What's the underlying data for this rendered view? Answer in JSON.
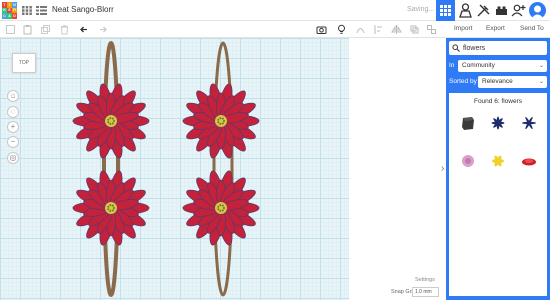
{
  "app": {
    "logo_letters": [
      "T",
      "I",
      "N",
      "K",
      "E",
      "R",
      "C",
      "A",
      "D"
    ],
    "design_name": "Neat Sango-Blorr",
    "status_text": "Saving..."
  },
  "toolbar": {
    "import_label": "Import",
    "export_label": "Export",
    "sendto_label": "Send To"
  },
  "viewport": {
    "viewcube_label": "TOP",
    "settings_label": "Settings",
    "snap_grid_label": "Snap Grid",
    "snap_grid_value": "1.0 mm"
  },
  "panel": {
    "search_value": "flowers",
    "in_label": "In",
    "in_value": "Community",
    "sort_label": "Sorted by",
    "sort_value": "Relevance",
    "found_text": "Found 6: flowers",
    "thumbnails": [
      "dark-block-shape",
      "navy-flower-shape",
      "navy-star-flower-shape",
      "pink-flower-shape",
      "yellow-flower-shape",
      "red-flower-shape"
    ]
  },
  "colors": {
    "accent": "#2f7bf5",
    "petal": "#c4213b",
    "stem": "#8a6a4a",
    "center": "#d5c64a"
  }
}
